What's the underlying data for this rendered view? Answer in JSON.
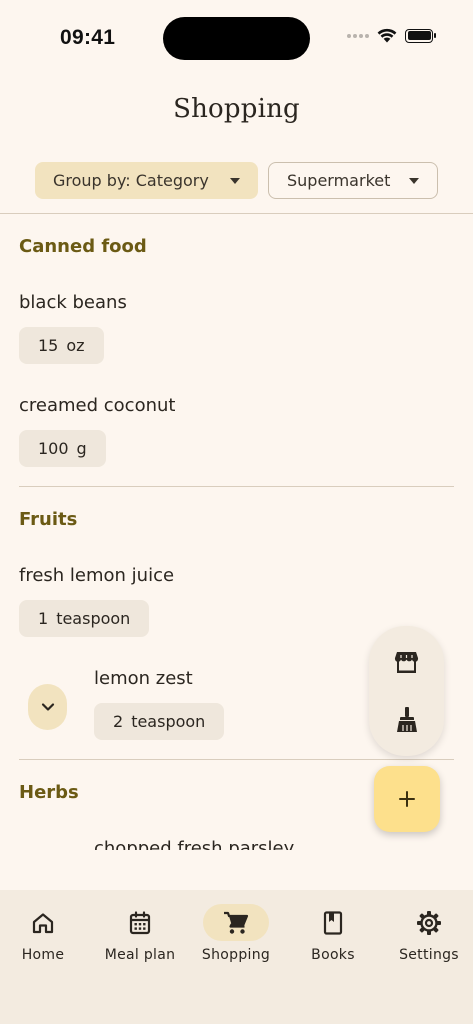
{
  "status_bar": {
    "time": "09:41"
  },
  "header": {
    "title": "Shopping"
  },
  "filters": {
    "group_by": "Group by: Category",
    "store": "Supermarket"
  },
  "sections": [
    {
      "title": "Canned food",
      "items": [
        {
          "name": "black beans",
          "amount": "15",
          "unit": "oz"
        },
        {
          "name": "creamed coconut",
          "amount": "100",
          "unit": "g"
        }
      ]
    },
    {
      "title": "Fruits",
      "items": [
        {
          "name": "fresh lemon juice",
          "amount": "1",
          "unit": "teaspoon"
        },
        {
          "name": "lemon zest",
          "amount": "2",
          "unit": "teaspoon"
        }
      ]
    },
    {
      "title": "Herbs",
      "items": [
        {
          "name": "chopped fresh parsley"
        }
      ]
    }
  ],
  "nav": [
    {
      "label": "Home",
      "icon": "home-icon"
    },
    {
      "label": "Meal plan",
      "icon": "calendar-icon"
    },
    {
      "label": "Shopping",
      "icon": "cart-icon"
    },
    {
      "label": "Books",
      "icon": "book-icon"
    },
    {
      "label": "Settings",
      "icon": "gear-icon"
    }
  ],
  "colors": {
    "background": "#fdf6ef",
    "accent_container": "#f2e3bf",
    "section_title": "#6b5a14",
    "fab": "#fde08c",
    "nav_background": "#f3ebe0"
  }
}
